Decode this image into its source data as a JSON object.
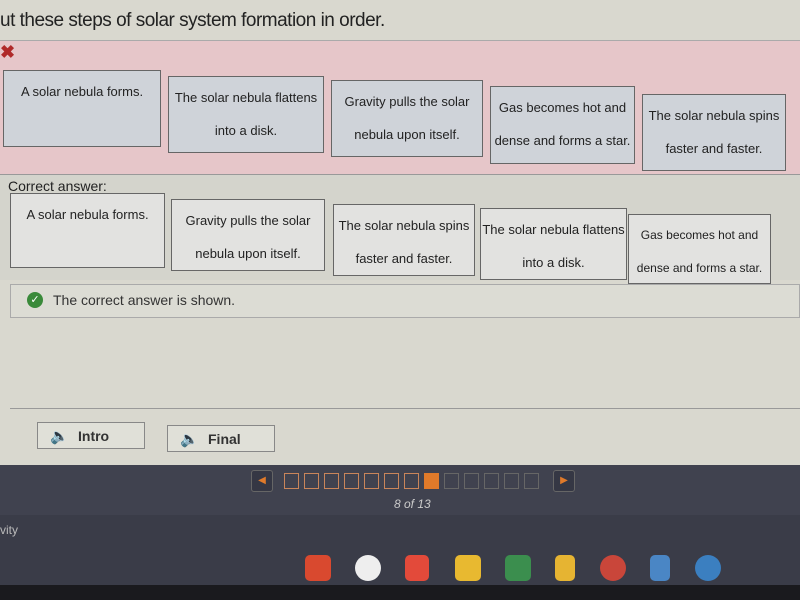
{
  "question": "ut these steps of solar system formation in order.",
  "incorrect_icon": "x-icon",
  "user_answer": [
    [
      "A solar nebula forms.",
      ""
    ],
    [
      "The solar nebula flattens",
      "into a disk."
    ],
    [
      "Gravity pulls the solar",
      "nebula upon itself."
    ],
    [
      "Gas becomes hot and",
      "dense and forms a star."
    ],
    [
      "The solar nebula spins",
      "faster and faster."
    ]
  ],
  "correct_label": "Correct answer:",
  "correct_answer": [
    [
      "A solar nebula forms.",
      ""
    ],
    [
      "Gravity pulls the solar",
      "nebula upon itself."
    ],
    [
      "The solar nebula spins",
      "faster and faster."
    ],
    [
      "The solar nebula flattens",
      "into a disk."
    ],
    [
      "Gas becomes hot and",
      "dense and forms a star."
    ]
  ],
  "feedback": "The correct answer is shown.",
  "audio": {
    "intro": "Intro",
    "final": "Final"
  },
  "pagination": {
    "current": 8,
    "total": 13,
    "label": "8 of 13"
  },
  "shelf": {
    "partial_text": "vity",
    "apps": [
      "youtube-icon",
      "play-store-icon",
      "gmail-icon",
      "keep-icon",
      "drive-icon",
      "slides-icon",
      "chrome-icon",
      "docs-icon",
      "files-icon"
    ]
  },
  "colors": {
    "incorrect_band": "#e6c6c9",
    "current_page": "#e07a2a",
    "check": "#3a8a3a"
  }
}
